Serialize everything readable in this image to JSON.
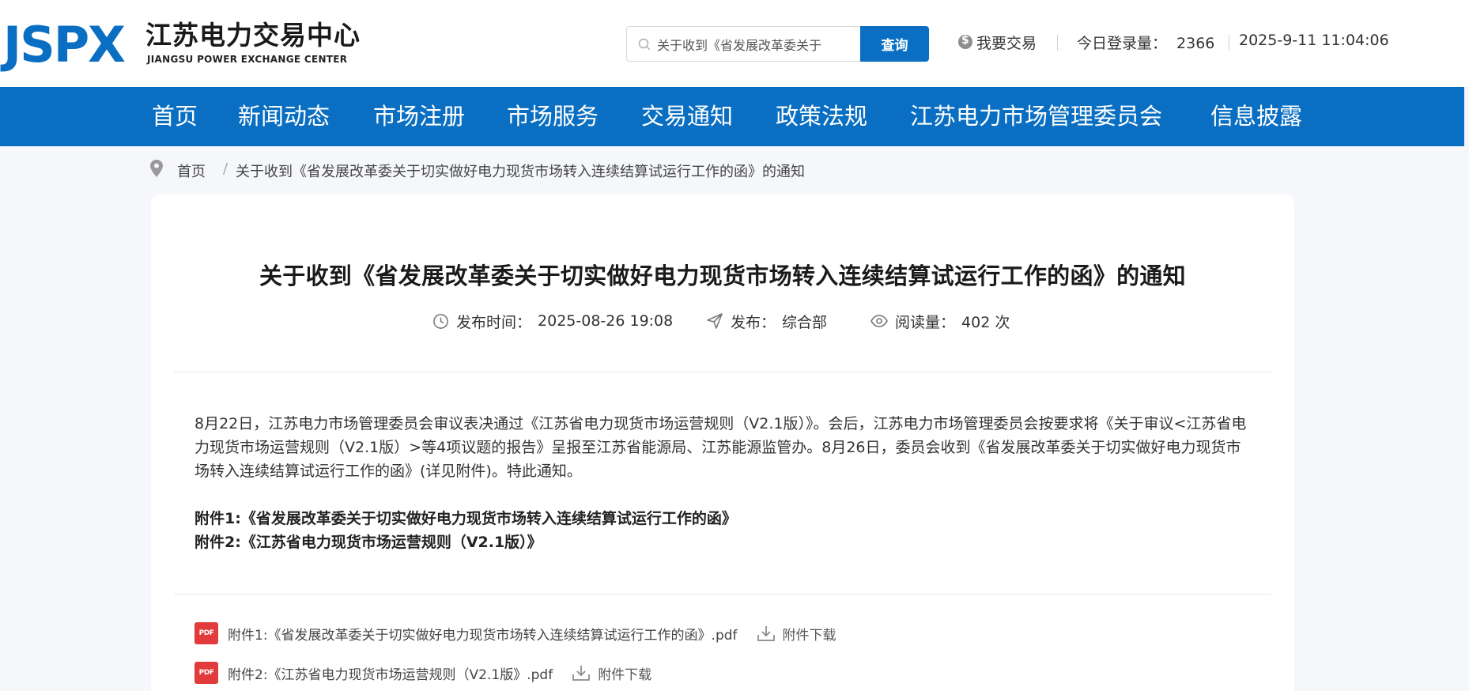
{
  "header": {
    "logo_mark": "JSPX",
    "logo_cn": "江苏电力交易中心",
    "logo_en": "JIANGSU POWER EXCHANGE CENTER",
    "search": {
      "value": "关于收到《省发展改革委关于",
      "button": "查询"
    },
    "trade_label": "我要交易",
    "login_label": "今日登录量：",
    "login_count": "2366",
    "datetime": "2025-9-11 11:04:06"
  },
  "nav": {
    "items": [
      "首页",
      "新闻动态",
      "市场注册",
      "市场服务",
      "交易通知",
      "政策法规",
      "江苏电力市场管理委员会",
      "信息披露"
    ]
  },
  "breadcrumb": {
    "home": "首页",
    "sep": "/",
    "current": "关于收到《省发展改革委关于切实做好电力现货市场转入连续结算试运行工作的函》的通知"
  },
  "article": {
    "title": "关于收到《省发展改革委关于切实做好电力现货市场转入连续结算试运行工作的函》的通知",
    "meta": {
      "time_label": "发布时间：",
      "time": "2025-08-26 19:08",
      "publisher_label": "发布：",
      "publisher": "综合部",
      "views_label": "阅读量：",
      "views": "402 次"
    },
    "body": "8月22日，江苏电力市场管理委员会审议表决通过《江苏省电力现货市场运营规则（V2.1版）》。会后，江苏电力市场管理委员会按要求将《关于审议<江苏省电力现货市场运营规则（V2.1版）>等4项议题的报告》呈报至江苏省能源局、江苏能源监管办。8月26日，委员会收到《省发展改革委关于切实做好电力现货市场转入连续结算试运行工作的函》(详见附件)。特此通知。",
    "attachments_text": [
      "附件1:《省发展改革委关于切实做好电力现货市场转入连续结算试运行工作的函》",
      "附件2:《江苏省电力现货市场运营规则（V2.1版）》"
    ],
    "files": [
      {
        "name": "附件1:《省发展改革委关于切实做好电力现货市场转入连续结算试运行工作的函》.pdf",
        "download": "附件下载"
      },
      {
        "name": "附件2:《江苏省电力现货市场运营规则（V2.1版》.pdf",
        "download": "附件下载"
      }
    ],
    "pdf_icon_text": "PDF"
  }
}
